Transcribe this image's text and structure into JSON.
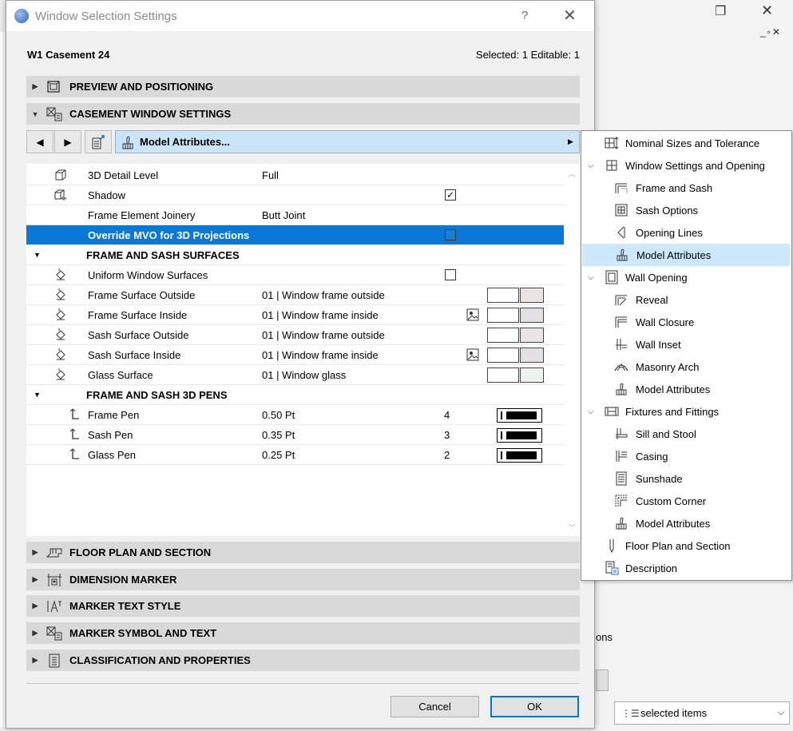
{
  "window": {
    "title": "Window Selection Settings",
    "help": "?",
    "close": "✕"
  },
  "header": {
    "element_name": "W1 Casement 24",
    "selection_info": "Selected: 1 Editable: 1"
  },
  "sections": {
    "preview": "PREVIEW AND POSITIONING",
    "casement": "CASEMENT WINDOW SETTINGS",
    "floor_plan": "FLOOR PLAN AND SECTION",
    "dimension": "DIMENSION MARKER",
    "marker_text": "MARKER TEXT STYLE",
    "marker_symbol": "MARKER SYMBOL AND TEXT",
    "classification": "CLASSIFICATION AND PROPERTIES"
  },
  "toolbar": {
    "page_dropdown_label": "Model Attributes..."
  },
  "grid": {
    "rows": [
      {
        "label": "3D Detail Level",
        "value": "Full"
      },
      {
        "label": "Shadow",
        "checked": true
      },
      {
        "label": "Frame Element Joinery",
        "value": "Butt Joint"
      },
      {
        "label": "Override MVO for 3D Projections",
        "checked": false
      }
    ],
    "group_surfaces": "FRAME AND SASH SURFACES",
    "surfaces": [
      {
        "label": "Uniform Window Surfaces"
      },
      {
        "label": "Frame Surface Outside",
        "value": "01 | Window frame outside",
        "color": "#ece3e3"
      },
      {
        "label": "Frame Surface Inside",
        "value": "01 | Window frame inside",
        "color": "#e3dfe3"
      },
      {
        "label": "Sash Surface Outside",
        "value": "01 | Window frame outside",
        "color": "#ece3e3"
      },
      {
        "label": "Sash Surface Inside",
        "value": "01 | Window frame inside",
        "color": "#e3dfe3"
      },
      {
        "label": "Glass Surface",
        "value": "01 | Window glass",
        "color": "#ecf2ee"
      }
    ],
    "group_pens": "FRAME AND SASH 3D PENS",
    "pens": [
      {
        "label": "Frame Pen",
        "value": "0.50 Pt",
        "number": "4"
      },
      {
        "label": "Sash Pen",
        "value": "0.35 Pt",
        "number": "3"
      },
      {
        "label": "Glass Pen",
        "value": "0.25 Pt",
        "number": "2"
      }
    ]
  },
  "buttons": {
    "cancel": "Cancel",
    "ok": "OK"
  },
  "menu": {
    "items": [
      {
        "label": "Nominal Sizes and Tolerance"
      },
      {
        "label": "Window Settings and Opening"
      },
      {
        "label": "Frame and Sash"
      },
      {
        "label": "Sash Options"
      },
      {
        "label": "Opening Lines"
      },
      {
        "label": "Model Attributes"
      },
      {
        "label": "Wall Opening"
      },
      {
        "label": "Reveal"
      },
      {
        "label": "Wall Closure"
      },
      {
        "label": "Wall Inset"
      },
      {
        "label": "Masonry Arch"
      },
      {
        "label": "Model Attributes"
      },
      {
        "label": "Fixtures and Fittings"
      },
      {
        "label": "Sill and Stool"
      },
      {
        "label": "Casing"
      },
      {
        "label": "Sunshade"
      },
      {
        "label": "Custom Corner"
      },
      {
        "label": "Model Attributes"
      },
      {
        "label": "Floor Plan and Section"
      },
      {
        "label": "Description"
      }
    ]
  },
  "background": {
    "partial_text": "ons",
    "select_value": "selected items"
  },
  "colors": {
    "selection_blue": "#0a78d7",
    "menu_highlight": "#cce8ff",
    "dropdown_bg": "#cce4f7"
  }
}
